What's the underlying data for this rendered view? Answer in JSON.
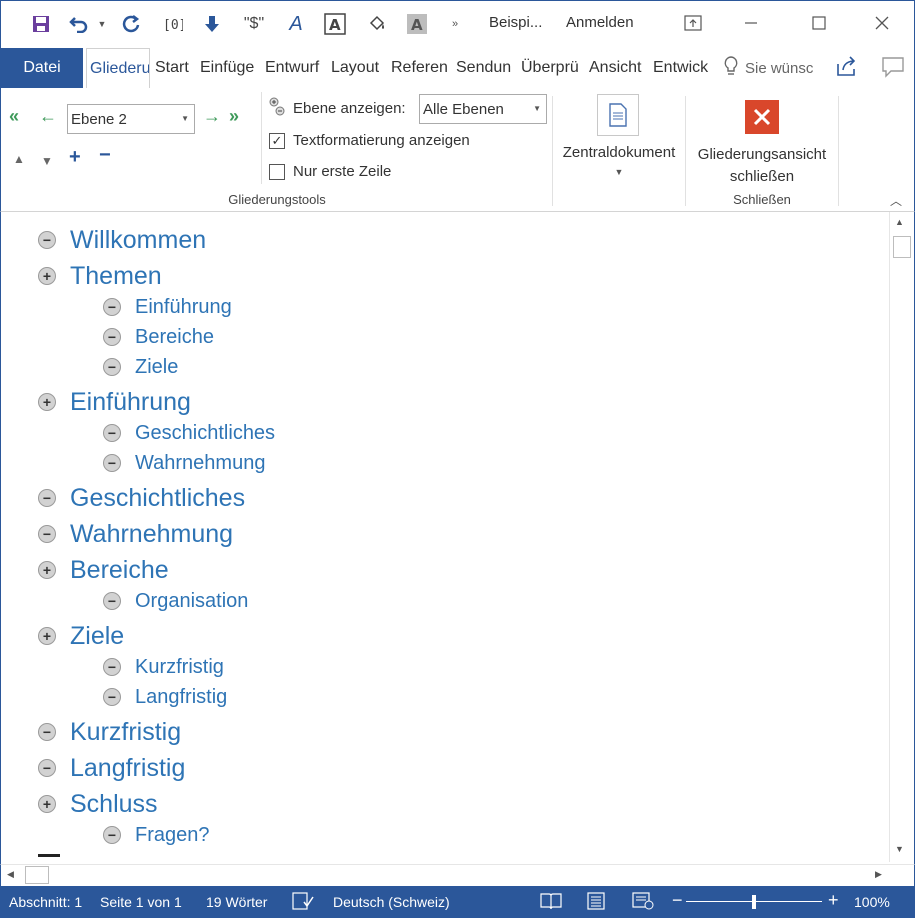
{
  "titlebar": {
    "doc_title": "Beispi...",
    "signin": "Anmelden",
    "qa_dollar": "\"$\""
  },
  "tabs": {
    "file": "Datei",
    "items": [
      "Gliederu",
      "Start",
      "Einfüge",
      "Entwurf",
      "Layout",
      "Referen",
      "Sendun",
      "Überprü",
      "Ansicht",
      "Entwick"
    ],
    "tellme": "Sie wünsc"
  },
  "ribbon": {
    "level_value": "Ebene 2",
    "show_level_label": "Ebene anzeigen:",
    "show_level_value": "Alle Ebenen",
    "show_formatting_label": "Textformatierung anzeigen",
    "show_formatting_checked": true,
    "first_line_label": "Nur erste Zeile",
    "first_line_checked": false,
    "master_doc_label": "Zentraldokument",
    "close_outline_line1": "Gliederungsansicht",
    "close_outline_line2": "schließen",
    "group_outline_tools": "Gliederungstools",
    "group_close": "Schließen"
  },
  "outline": [
    {
      "text": "Willkommen",
      "level": 1,
      "symbol": "minus"
    },
    {
      "text": "Themen",
      "level": 1,
      "symbol": "plus"
    },
    {
      "text": "Einführung",
      "level": 2,
      "symbol": "minus"
    },
    {
      "text": "Bereiche",
      "level": 2,
      "symbol": "minus"
    },
    {
      "text": "Ziele",
      "level": 2,
      "symbol": "minus"
    },
    {
      "text": "Einführung",
      "level": 1,
      "symbol": "plus"
    },
    {
      "text": "Geschichtliches",
      "level": 2,
      "symbol": "minus"
    },
    {
      "text": "Wahrnehmung",
      "level": 2,
      "symbol": "minus"
    },
    {
      "text": "Geschichtliches",
      "level": 1,
      "symbol": "minus"
    },
    {
      "text": "Wahrnehmung",
      "level": 1,
      "symbol": "minus"
    },
    {
      "text": "Bereiche",
      "level": 1,
      "symbol": "plus"
    },
    {
      "text": "Organisation",
      "level": 2,
      "symbol": "minus"
    },
    {
      "text": "Ziele",
      "level": 1,
      "symbol": "plus"
    },
    {
      "text": "Kurzfristig",
      "level": 2,
      "symbol": "minus"
    },
    {
      "text": "Langfristig",
      "level": 2,
      "symbol": "minus"
    },
    {
      "text": "Kurzfristig",
      "level": 1,
      "symbol": "minus"
    },
    {
      "text": "Langfristig",
      "level": 1,
      "symbol": "minus"
    },
    {
      "text": "Schluss",
      "level": 1,
      "symbol": "plus"
    },
    {
      "text": "Fragen?",
      "level": 2,
      "symbol": "minus"
    }
  ],
  "statusbar": {
    "section": "Abschnitt: 1",
    "page": "Seite 1 von 1",
    "words": "19 Wörter",
    "language": "Deutsch (Schweiz)",
    "zoom": "100%",
    "zoom_fraction": 0.5
  },
  "colors": {
    "accent": "#2b579a",
    "heading": "#2e74b5",
    "close_red": "#d9472b",
    "arrow_green": "#3e9a5a"
  }
}
